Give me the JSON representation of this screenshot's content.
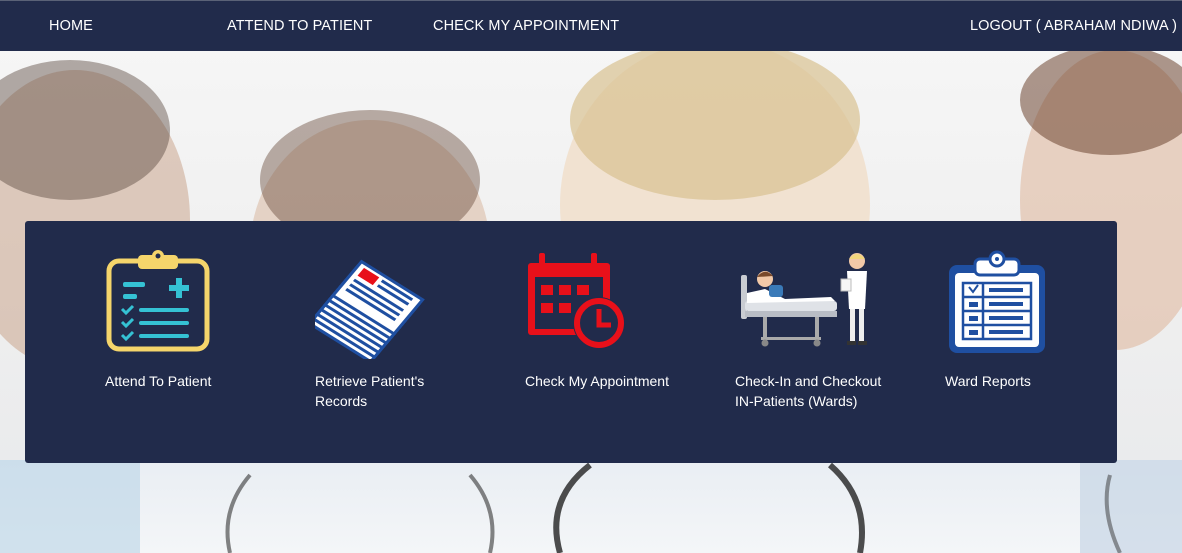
{
  "nav": {
    "home": "HOME",
    "attend": "ATTEND TO PATIENT",
    "appointment": "CHECK MY APPOINTMENT",
    "logout": "LOGOUT ( ABRAHAM NDIWA )"
  },
  "tiles": [
    {
      "label": "Attend To Patient",
      "icon": "clipboard-medical-icon"
    },
    {
      "label": "Retrieve Patient's Records",
      "icon": "records-stack-icon"
    },
    {
      "label": "Check My Appointment",
      "icon": "calendar-clock-icon"
    },
    {
      "label": "Check-In and Checkout IN-Patients (Wards)",
      "icon": "hospital-bed-icon"
    },
    {
      "label": "Ward Reports",
      "icon": "report-clipboard-icon"
    }
  ],
  "colors": {
    "navbar": "#212b4b",
    "panel": "#212b4b",
    "accent_yellow": "#f5d56b",
    "accent_teal": "#35c2d4",
    "accent_red": "#e8101a",
    "accent_blue": "#1f4fa1"
  }
}
